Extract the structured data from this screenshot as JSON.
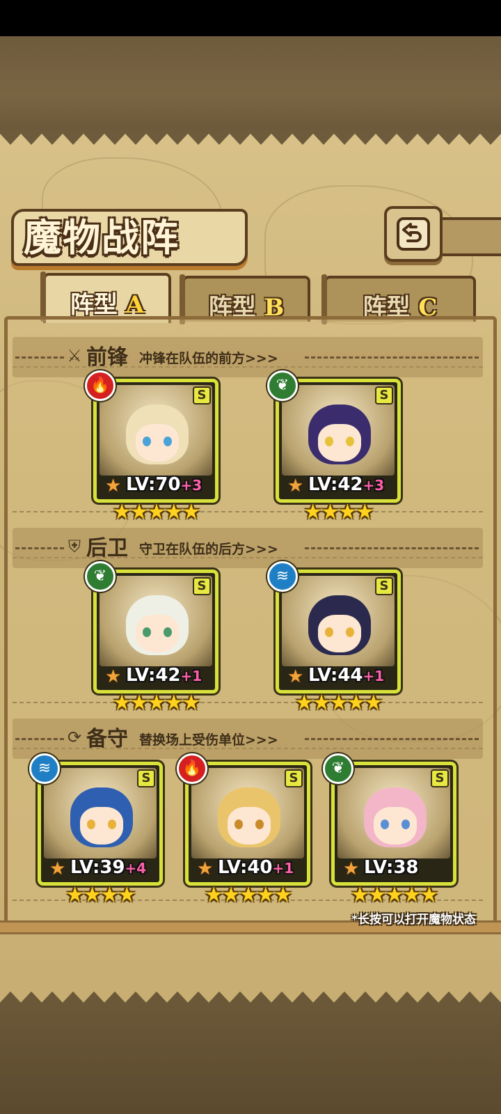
{
  "title": "魔物战阵",
  "tabs": [
    {
      "prefix": "阵型",
      "letter": "A",
      "active": true
    },
    {
      "prefix": "阵型",
      "letter": "B",
      "active": false
    },
    {
      "prefix": "阵型",
      "letter": "C",
      "active": false
    }
  ],
  "sections": [
    {
      "icon": "sword-icon",
      "title": "前锋",
      "desc": "冲锋在队伍的前方>>>"
    },
    {
      "icon": "shield-icon",
      "title": "后卫",
      "desc": "守卫在队伍的后方>>>"
    },
    {
      "icon": "swap-icon",
      "title": "备守",
      "desc": "替换场上受伤单位>>>"
    }
  ],
  "cards": [
    {
      "element": "fire",
      "rarity": "S",
      "level": "LV:70",
      "bonus": "+3",
      "stars": 5,
      "hair": "#efe0b8",
      "eye": "#4aa3d8"
    },
    {
      "element": "leaf",
      "rarity": "S",
      "level": "LV:42",
      "bonus": "+3",
      "stars": 4,
      "hair": "#3b2c6e",
      "eye": "#e6c23a"
    },
    {
      "element": "leaf",
      "rarity": "S",
      "level": "LV:42",
      "bonus": "+1",
      "stars": 5,
      "hair": "#eef0e6",
      "eye": "#4b9a6a"
    },
    {
      "element": "water",
      "rarity": "S",
      "level": "LV:44",
      "bonus": "+1",
      "stars": 5,
      "hair": "#2b2a4e",
      "eye": "#e8b23a"
    },
    {
      "element": "water",
      "rarity": "S",
      "level": "LV:39",
      "bonus": "+4",
      "stars": 4,
      "hair": "#2f5fb0",
      "eye": "#e8b23a"
    },
    {
      "element": "fire",
      "rarity": "S",
      "level": "LV:40",
      "bonus": "+1",
      "stars": 5,
      "hair": "#e9c46a",
      "eye": "#c98a2a"
    },
    {
      "element": "leaf",
      "rarity": "S",
      "level": "LV:38",
      "bonus": "",
      "stars": 5,
      "hair": "#f3b6c8",
      "eye": "#5a8fd6"
    }
  ],
  "hint": "*长按可以打开魔物状态",
  "colors": {
    "panel": "#cdb579",
    "frame": "#d9e23a",
    "fire": "#d42020",
    "leaf": "#2e7d32",
    "water": "#1e7fc4"
  }
}
